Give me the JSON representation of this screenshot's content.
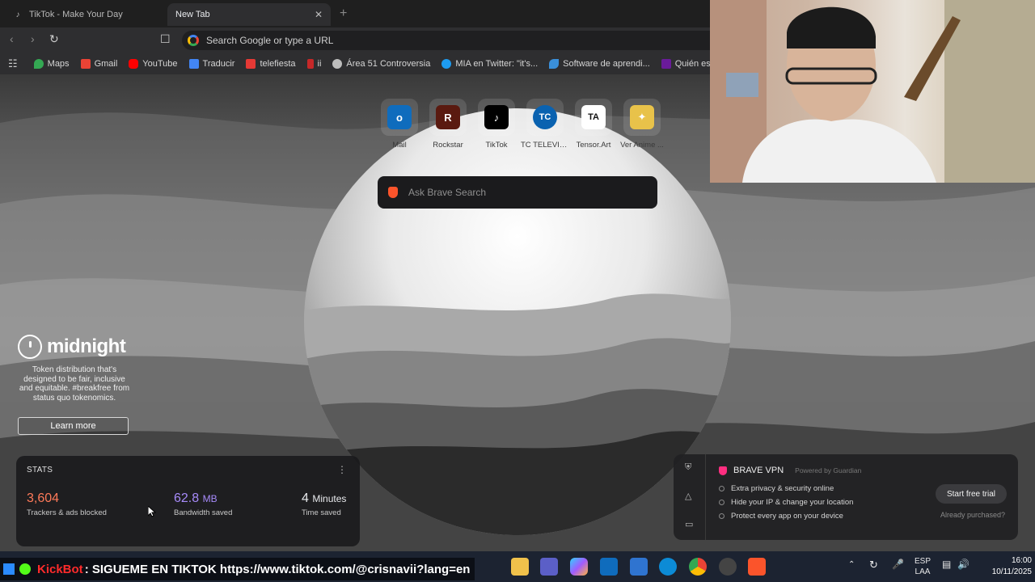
{
  "tabs": [
    {
      "label": "TikTok - Make Your Day",
      "active": false
    },
    {
      "label": "New Tab",
      "active": true
    }
  ],
  "omnibox": {
    "placeholder": "Search Google or type a URL"
  },
  "bookmarks": [
    {
      "label": "Maps",
      "icon": "maps-pin-icon",
      "color": "#34a853"
    },
    {
      "label": "Gmail",
      "icon": "gmail-icon",
      "color": "#ea4335"
    },
    {
      "label": "YouTube",
      "icon": "youtube-icon",
      "color": "#ff0000"
    },
    {
      "label": "Traducir",
      "icon": "translate-icon",
      "color": "#4285f4"
    },
    {
      "label": "telefiesta",
      "icon": "telefiesta-icon",
      "color": "#e53935"
    },
    {
      "label": "ii",
      "icon": "bookmark-red-icon",
      "color": "#c62828"
    },
    {
      "label": "Área 51 Controversia",
      "icon": "openai-icon",
      "color": "#bdbdbd"
    },
    {
      "label": "MIA en Twitter: \"it's...",
      "icon": "twitter-icon",
      "color": "#1d9bf0"
    },
    {
      "label": "Software de aprendi...",
      "icon": "leaf-icon",
      "color": "#3a8fd9"
    },
    {
      "label": "Quién está vien",
      "icon": "m-icon",
      "color": "#6a1b9a"
    }
  ],
  "shortcuts": [
    {
      "label": "Mail",
      "icon": "outlook-icon",
      "color": "#0f6cbd",
      "glyph": "o"
    },
    {
      "label": "Rockstar",
      "icon": "rockstar-icon",
      "color": "#5a1a10",
      "glyph": "R"
    },
    {
      "label": "TikTok",
      "icon": "tiktok-icon",
      "color": "#000000",
      "glyph": "♪"
    },
    {
      "label": "TC TELEVISI...",
      "icon": "tc-icon",
      "color": "#0a62b0",
      "glyph": "TC"
    },
    {
      "label": "Tensor.Art",
      "icon": "tensor-art-icon",
      "color": "#ffffff",
      "glyph": "TA"
    },
    {
      "label": "Ver Anime ...",
      "icon": "anime-icon",
      "color": "#e8c24a",
      "glyph": "✦"
    }
  ],
  "search": {
    "placeholder": "Ask Brave Search"
  },
  "ad": {
    "brand": "midnight",
    "text": "Token distribution that's designed to be fair, inclusive and equitable. #breakfree from status quo tokenomics.",
    "button": "Learn more"
  },
  "stats": {
    "title": "STATS",
    "trackers_value": "3,604",
    "trackers_label": "Trackers & ads blocked",
    "trackers_color": "#ff7a59",
    "bandwidth_value": "62.8",
    "bandwidth_unit": "MB",
    "bandwidth_label": "Bandwidth saved",
    "bandwidth_color": "#a78bfa",
    "time_value": "4",
    "time_unit": "Minutes",
    "time_label": "Time saved"
  },
  "vpn": {
    "title": "BRAVE VPN",
    "powered": "Powered by Guardian",
    "features": [
      "Extra privacy & security online",
      "Hide your IP & change your location",
      "Protect every app on your device"
    ],
    "cta": "Start free trial",
    "already": "Already purchased?"
  },
  "kick": {
    "name": "KickBot",
    "message": ": SIGUEME EN TIKTOK https://www.tiktok.com/@crisnavii?lang=en"
  },
  "tray": {
    "lang1": "ESP",
    "lang2": "LAA",
    "time": "16:00",
    "date": "10/11/2025"
  }
}
